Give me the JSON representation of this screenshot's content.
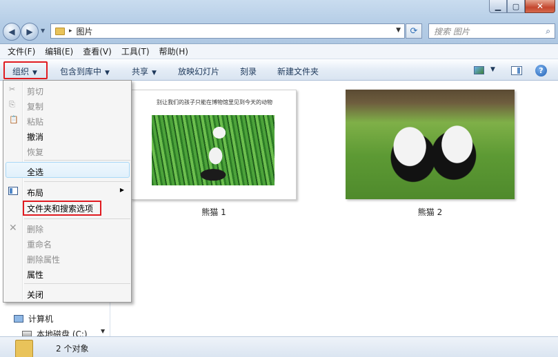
{
  "window": {
    "minimize_glyph": "▁",
    "maximize_glyph": "▢",
    "close_glyph": "✕"
  },
  "address_bar": {
    "path_separator": "▸",
    "path": "图片",
    "dropdown_glyph": "▼",
    "refresh_glyph": "⟳"
  },
  "search": {
    "placeholder": "搜索 图片",
    "icon_glyph": "⌕"
  },
  "menubar": {
    "items": [
      "文件(F)",
      "编辑(E)",
      "查看(V)",
      "工具(T)",
      "帮助(H)"
    ]
  },
  "toolbar": {
    "organize": "组织",
    "include_in_library": "包含到库中",
    "share": "共享",
    "slideshow": "放映幻灯片",
    "burn": "刻录",
    "new_folder": "新建文件夹",
    "caret": "▼",
    "help_glyph": "?"
  },
  "organize_menu": {
    "items": [
      {
        "label": "剪切",
        "enabled": false
      },
      {
        "label": "复制",
        "enabled": false
      },
      {
        "label": "粘贴",
        "enabled": false
      },
      {
        "label": "撤消",
        "enabled": true
      },
      {
        "label": "恢复",
        "enabled": false
      },
      {
        "label": "全选",
        "enabled": true
      },
      {
        "label": "布局",
        "enabled": true
      },
      {
        "label": "文件夹和搜索选项",
        "enabled": true
      },
      {
        "label": "删除",
        "enabled": false
      },
      {
        "label": "重命名",
        "enabled": false
      },
      {
        "label": "删除属性",
        "enabled": false
      },
      {
        "label": "属性",
        "enabled": true
      },
      {
        "label": "关闭",
        "enabled": true
      }
    ],
    "submenu_arrow": "▶",
    "icons": {
      "cut": "✂",
      "copy": "⎘",
      "paste": "📋",
      "delete": "✕"
    }
  },
  "navpane": {
    "computer": "计算机",
    "local_disk": "本地磁盘 (C:)",
    "scroll_down_glyph": "▼"
  },
  "files": [
    {
      "name": "熊猫 1",
      "embedded_caption": "别让我们的孩子只能在博物馆里见到今天的动物"
    },
    {
      "name": "熊猫 2"
    }
  ],
  "statusbar": {
    "item_count": "2 个对象"
  },
  "colors": {
    "highlight_border": "#e0191f",
    "toolbar_text": "#1e395b"
  }
}
